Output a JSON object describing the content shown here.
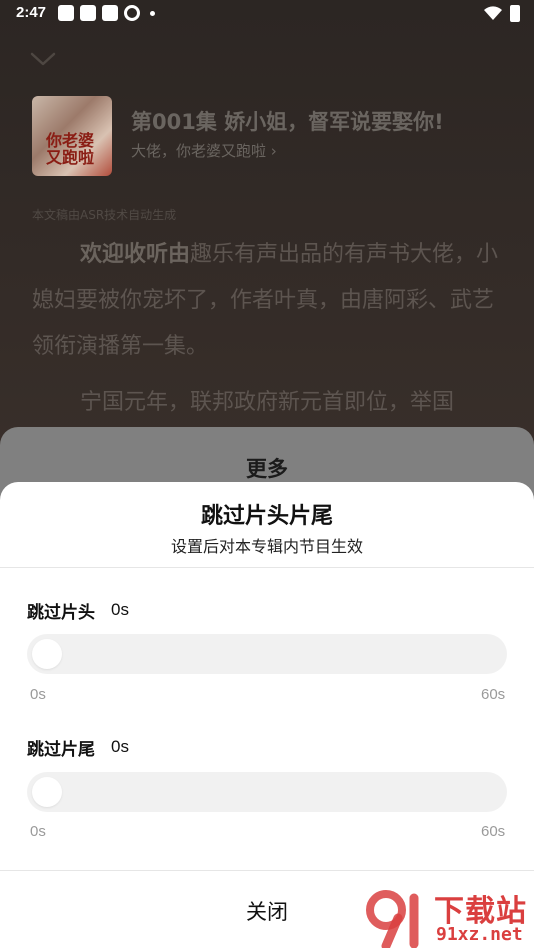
{
  "status_bar": {
    "time": "2:47"
  },
  "player": {
    "episode_title": "第001集 娇小姐，督军说要娶你!",
    "album_name": "大佬，你老婆又跑啦",
    "cover_text": "你老婆又跑啦",
    "asr_note": "本文稿由ASR技术自动生成",
    "transcript_highlight": "欢迎收听由",
    "transcript_p1_rest": "趣乐有声出品的有声书大佬，小媳妇要被你宠坏了，作者叶真，由唐阿彩、武艺领衔演播第一集。",
    "transcript_p2": "宁国元年，联邦政府新元首即位，举国"
  },
  "more_sheet": {
    "title": "更多"
  },
  "skip_dialog": {
    "title": "跳过片头片尾",
    "subtitle": "设置后对本专辑内节目生效",
    "intro": {
      "label": "跳过片头",
      "value": "0s",
      "min": "0s",
      "max": "60s",
      "level": 0
    },
    "outro": {
      "label": "跳过片尾",
      "value": "0s",
      "min": "0s",
      "max": "60s",
      "level": 0
    },
    "close_label": "关闭"
  },
  "watermark": {
    "text": "下载站",
    "url": "91xz.net"
  },
  "colors": {
    "sheet_bg": "#ffffff",
    "track": "#f1f1f1",
    "watermark": "#d62b2b"
  }
}
